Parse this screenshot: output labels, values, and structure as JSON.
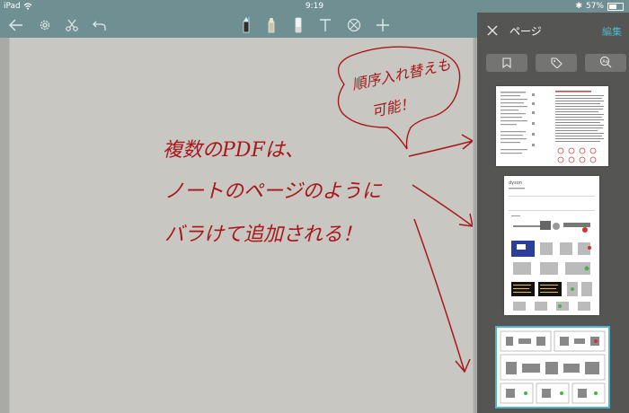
{
  "status_bar": {
    "device": "iPad",
    "time": "9:19",
    "battery": "57%",
    "battery_level": 0.57
  },
  "toolbar": {
    "icons": [
      "back-arrow-icon",
      "gear-icon",
      "scissors-icon",
      "undo-icon",
      "pen-icon",
      "highlighter-icon",
      "eraser-icon",
      "text-icon",
      "shape-icon",
      "add-icon"
    ]
  },
  "handwriting": {
    "bubble_line1": "順序入れ替えも",
    "bubble_line2": "可能！",
    "line1": "複数のPDFは、",
    "line2": "ノートのページのように",
    "line3": "バラけて追加される！"
  },
  "sidebar": {
    "title": "ページ",
    "edit_label": "編集",
    "filters": [
      "bookmark-icon",
      "tag-icon",
      "search-text-icon"
    ],
    "thumbnails": [
      {
        "name": "page-thumbnail-1",
        "selected": false
      },
      {
        "name": "page-thumbnail-2",
        "selected": false,
        "brand": "dyson"
      },
      {
        "name": "page-thumbnail-3",
        "selected": true
      }
    ]
  },
  "colors": {
    "toolbar": "#6f8f93",
    "sidebar": "#555553",
    "accent": "#4fb6c7",
    "ink": "#a8171b",
    "page": "#c9c7c1"
  }
}
